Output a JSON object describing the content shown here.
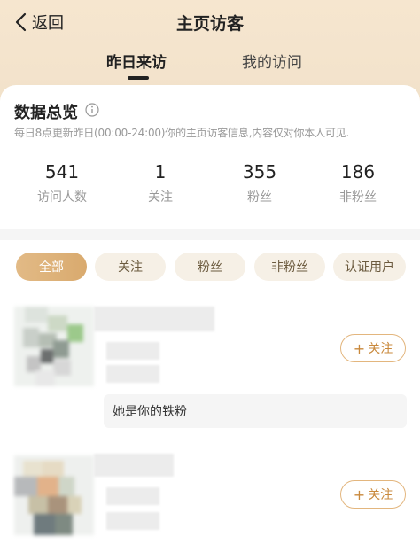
{
  "header": {
    "back_label": "返回",
    "title": "主页访客"
  },
  "tabs": [
    {
      "label": "昨日来访",
      "active": true
    },
    {
      "label": "我的访问",
      "active": false
    }
  ],
  "overview": {
    "title": "数据总览",
    "description": "每日8点更新昨日(00:00-24:00)你的主页访客信息,内容仅对你本人可见."
  },
  "stats": [
    {
      "value": "541",
      "label": "访问人数"
    },
    {
      "value": "1",
      "label": "关注"
    },
    {
      "value": "355",
      "label": "粉丝"
    },
    {
      "value": "186",
      "label": "非粉丝"
    }
  ],
  "filters": [
    {
      "label": "全部",
      "active": true
    },
    {
      "label": "关注",
      "active": false
    },
    {
      "label": "粉丝",
      "active": false
    },
    {
      "label": "非粉丝",
      "active": false
    },
    {
      "label": "认证用户",
      "active": false
    }
  ],
  "visitors": [
    {
      "follow_label": "关注",
      "note": "她是你的铁粉"
    },
    {
      "follow_label": "关注",
      "note": ""
    }
  ],
  "colors": {
    "accent": "#d9aa6e",
    "header_bg": "#f3e3cc",
    "follow_text": "#c9893c"
  }
}
